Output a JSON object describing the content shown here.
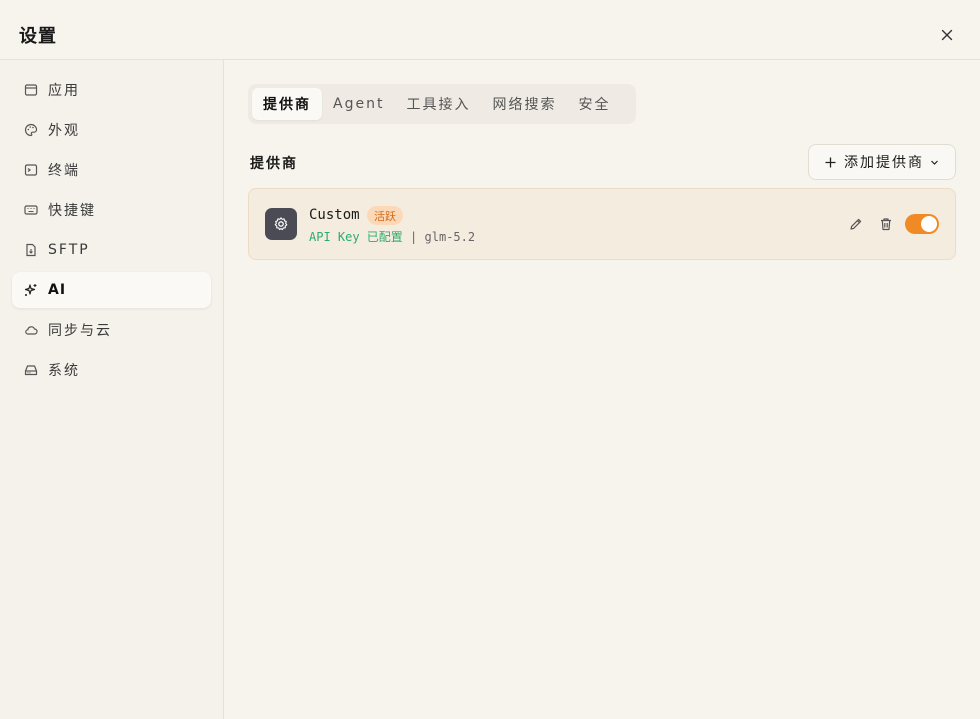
{
  "dialog": {
    "title": "设置"
  },
  "sidebar": {
    "items": [
      {
        "label": "应用",
        "icon": "window-icon"
      },
      {
        "label": "外观",
        "icon": "palette-icon"
      },
      {
        "label": "终端",
        "icon": "terminal-icon"
      },
      {
        "label": "快捷键",
        "icon": "keyboard-icon"
      },
      {
        "label": "SFTP",
        "icon": "file-icon"
      },
      {
        "label": "AI",
        "icon": "sparkles-icon",
        "active": true
      },
      {
        "label": "同步与云",
        "icon": "cloud-icon"
      },
      {
        "label": "系统",
        "icon": "drive-icon"
      }
    ]
  },
  "tabs": [
    {
      "label": "提供商",
      "active": true
    },
    {
      "label": "Agent"
    },
    {
      "label": "工具接入"
    },
    {
      "label": "网络搜索"
    },
    {
      "label": "安全"
    }
  ],
  "providers": {
    "section_title": "提供商",
    "add_label": "添加提供商",
    "items": [
      {
        "name": "Custom",
        "badge": "活跃",
        "status": "API Key 已配置",
        "separator": "|",
        "model": "glm-5.2",
        "enabled": true
      }
    ]
  },
  "colors": {
    "accent": "#f08a24",
    "success": "#2eab6c",
    "badge_bg": "#fbd9b8",
    "badge_text": "#d26a1a"
  }
}
